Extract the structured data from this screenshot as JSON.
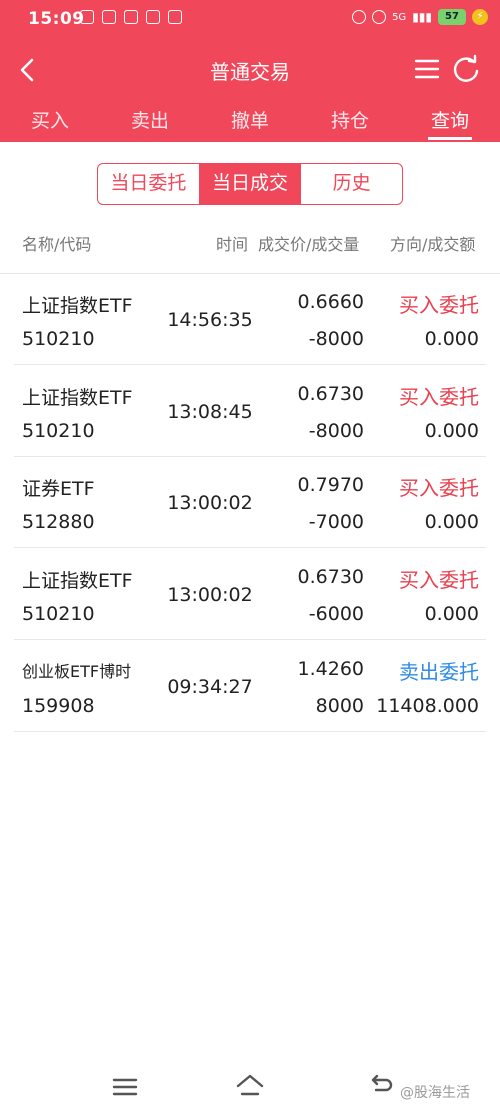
{
  "status_bar": {
    "time": "15:09",
    "network": "5G",
    "battery": "57"
  },
  "nav": {
    "title": "普通交易"
  },
  "tabs": [
    {
      "label": "买入",
      "active": false
    },
    {
      "label": "卖出",
      "active": false
    },
    {
      "label": "撤单",
      "active": false
    },
    {
      "label": "持仓",
      "active": false
    },
    {
      "label": "查询",
      "active": true
    }
  ],
  "segment": [
    {
      "label": "当日委托",
      "active": false
    },
    {
      "label": "当日成交",
      "active": true
    },
    {
      "label": "历史",
      "active": false
    }
  ],
  "columns": {
    "name_code": "名称/代码",
    "time": "时间",
    "price_qty": "成交价/成交量",
    "dir_amount": "方向/成交额"
  },
  "rows": [
    {
      "name": "上证指数ETF",
      "code": "510210",
      "time": "14:56:35",
      "price": "0.6660",
      "qty": "-8000",
      "direction": "买入委托",
      "amount": "0.000"
    },
    {
      "name": "上证指数ETF",
      "code": "510210",
      "time": "13:08:45",
      "price": "0.6730",
      "qty": "-8000",
      "direction": "买入委托",
      "amount": "0.000"
    },
    {
      "name": "证券ETF",
      "code": "512880",
      "time": "13:00:02",
      "price": "0.7970",
      "qty": "-7000",
      "direction": "买入委托",
      "amount": "0.000"
    },
    {
      "name": "上证指数ETF",
      "code": "510210",
      "time": "13:00:02",
      "price": "0.6730",
      "qty": "-6000",
      "direction": "买入委托",
      "amount": "0.000"
    },
    {
      "name": "创业板ETF博时",
      "code": "159908",
      "time": "09:34:27",
      "price": "1.4260",
      "qty": "8000",
      "direction": "卖出委托",
      "amount": "11408.000"
    }
  ],
  "colors": {
    "brand": "#f0485a",
    "buy": "#e8414f",
    "sell": "#2f8be5"
  },
  "watermark": "@股海生活"
}
